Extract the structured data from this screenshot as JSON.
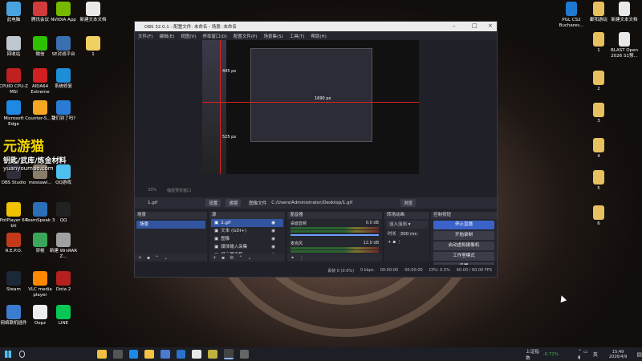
{
  "desktop_icons_left": [
    {
      "label": "此电脑",
      "color": "#4aa3df"
    },
    {
      "label": "腾讯会议",
      "color": "#d23b3b"
    },
    {
      "label": "NVIDIA App",
      "color": "#76b900"
    },
    {
      "label": "新建文本文档",
      "color": "#e8e8e8"
    },
    {
      "label": "回收站",
      "color": "#bfc7cf"
    },
    {
      "label": "微信",
      "color": "#2dc100"
    },
    {
      "label": "SE对战平台",
      "color": "#3a6fb0"
    },
    {
      "label": "1",
      "color": "#f0d060"
    },
    {
      "label": "CPUID CPU-Z MSI",
      "color": "#c02020"
    },
    {
      "label": "AIDA64 Extreme",
      "color": "#d02020"
    },
    {
      "label": "系统修复",
      "color": "#1d8ed8"
    },
    {
      "label": "Microsoft Edge",
      "color": "#1e88e5"
    },
    {
      "label": "Counter-S... 2",
      "color": "#f5a623"
    },
    {
      "label": "我们到了吗?",
      "color": "#2b7bd5"
    },
    {
      "label": "OBS Studio",
      "color": "#302e3a"
    },
    {
      "label": "mossawi...",
      "color": "#8a7d6a"
    },
    {
      "label": "QQ游戏",
      "color": "#4dc0f0"
    },
    {
      "label": "PotPlayer 64 bit",
      "color": "#f2c200"
    },
    {
      "label": "TeamSpeak 3",
      "color": "#2a6fb8"
    },
    {
      "label": "QQ",
      "color": "#222"
    },
    {
      "label": "R.E.P.O.",
      "color": "#c23a1a"
    },
    {
      "label": "穿梭",
      "color": "#3aa65a"
    },
    {
      "label": "新建 WinRAR Z...",
      "color": "#a0a0a0"
    },
    {
      "label": "Steam",
      "color": "#1b2838"
    },
    {
      "label": "VLC media player",
      "color": "#ff8800"
    },
    {
      "label": "Dota 2",
      "color": "#b52020"
    },
    {
      "label": "网络联机插件",
      "color": "#3b7bd0"
    },
    {
      "label": "Oopz",
      "color": "#eeeeee"
    },
    {
      "label": "LINE",
      "color": "#06c755"
    }
  ],
  "desktop_icons_right": [
    {
      "label": "PGL CS2 Buchares...",
      "color": "#1e7ad0"
    },
    {
      "label": "鄱阳游玩",
      "color": "#e7c060"
    },
    {
      "label": "新建文本文档",
      "color": "#e8e8e8"
    },
    {
      "label": "1",
      "color": "#e7c060"
    },
    {
      "label": "BLAST Open 2026 S1预...",
      "color": "#e8e8e8"
    },
    {
      "label": "2",
      "color": "#e7c060"
    },
    {
      "label": "3",
      "color": "#e7c060"
    },
    {
      "label": "4",
      "color": "#e7c060"
    },
    {
      "label": "5",
      "color": "#e7c060"
    },
    {
      "label": "6",
      "color": "#e7c060"
    }
  ],
  "watermark": {
    "brand": "元游猫",
    "slogan": "钥匙/武库/炼金材料",
    "url": "yuanyoumao.com"
  },
  "obs": {
    "title": "OBS 32.0.1 - 配置文件: 未命名 - 场景: 未命名",
    "menu": [
      "文件(F)",
      "编辑(E)",
      "视图(V)",
      "停靠窗口(D)",
      "配置文件(P)",
      "场景集(S)",
      "工具(T)",
      "帮助(H)"
    ],
    "preview_overlay": {
      "w_label": "1690 px",
      "h_label1": "445 px",
      "h_label2": "525 px"
    },
    "source_bar": {
      "source": "1.gif",
      "properties": "设置",
      "filters": "滤镜",
      "image_file_label": "图像文件",
      "path": "C:/Users/Administrator/Desktop/1.gif",
      "browse": "浏览"
    },
    "zoom": "33%",
    "zoom_label": "缩放预览窗口",
    "docks": {
      "scenes": {
        "title": "场景",
        "items": [
          "场景"
        ]
      },
      "sources": {
        "title": "源",
        "items": [
          "1.gif",
          "文本 (GDI+)",
          "图像",
          "媒体输入采集",
          "显示器采集"
        ]
      },
      "mixer": {
        "title": "混音器",
        "channels": [
          {
            "name": "桌面音频",
            "db": "0.0 dB"
          },
          {
            "name": "麦克风",
            "db": "12.0 dB"
          }
        ]
      },
      "transitions": {
        "title": "转场动画",
        "type": "淡入淡出",
        "duration_label": "时长",
        "duration": "300 ms"
      },
      "controls": {
        "title": "控制按钮",
        "buttons": [
          "停止直播",
          "开始录制",
          "启动虚拟摄像机",
          "工作室模式",
          "设置"
        ]
      }
    },
    "status": {
      "dropped": "丢帧 0 (0.0%)",
      "bitrate": "0 kbps",
      "time1": "00:00:00",
      "time2": "00:00:00",
      "cpu": "CPU: 0.5%",
      "fps": "60.00 / 60.00 FPS"
    }
  },
  "taskbar": {
    "weather": "上证指数",
    "change": "-0.72%",
    "lang": "英",
    "time": "15:49",
    "date": "2026/4/9"
  }
}
